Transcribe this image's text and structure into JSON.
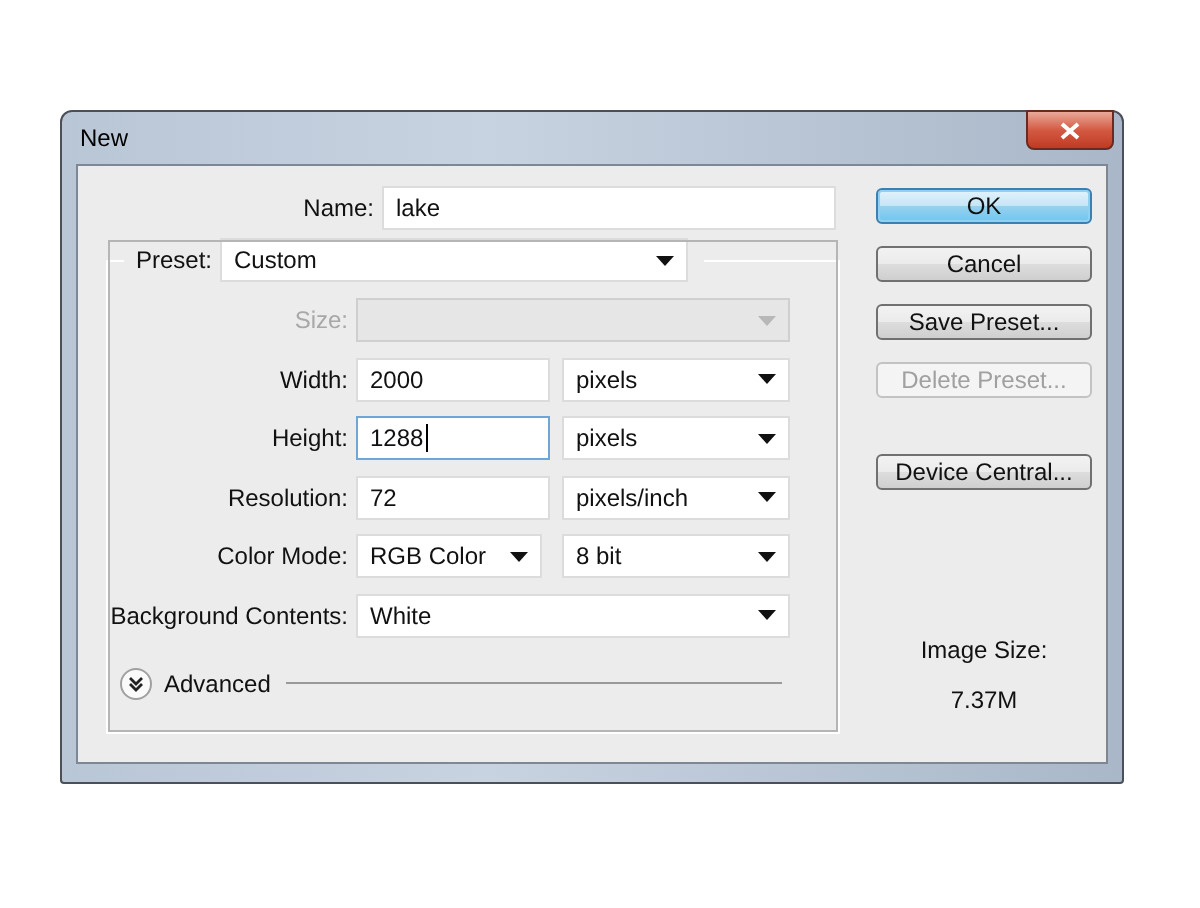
{
  "window": {
    "title": "New"
  },
  "name": {
    "label": "Name:",
    "value": "lake"
  },
  "preset": {
    "label": "Preset:",
    "value": "Custom"
  },
  "fields": [
    {
      "kind": "select-wide",
      "label": "Size:",
      "disabled": true
    },
    {
      "kind": "input-unit",
      "label": "Width:",
      "value": "2000",
      "unit": "pixels",
      "focused": false,
      "disabled": false
    },
    {
      "kind": "input-unit",
      "label": "Height:",
      "value": "1288",
      "unit": "pixels",
      "focused": true,
      "disabled": false
    },
    {
      "kind": "input-unit",
      "label": "Resolution:",
      "value": "72",
      "unit": "pixels/inch",
      "focused": false,
      "disabled": false
    },
    {
      "kind": "select-pair",
      "label": "Color Mode:",
      "value": "RGB Color",
      "unit": "8 bit",
      "disabled": false
    },
    {
      "kind": "select-wide",
      "label": "Background Contents:",
      "value": "White",
      "disabled": false
    }
  ],
  "advanced": {
    "label": "Advanced",
    "expanded": false
  },
  "buttons": [
    {
      "label": "OK",
      "default": true,
      "disabled": false
    },
    {
      "label": "Cancel",
      "default": false,
      "disabled": false
    },
    {
      "label": "Save Preset...",
      "default": false,
      "disabled": false
    },
    {
      "label": "Delete Preset...",
      "default": false,
      "disabled": true
    },
    {
      "label": "Device Central...",
      "default": false,
      "disabled": false
    }
  ],
  "image_size": {
    "label": "Image Size:",
    "value": "7.37M"
  }
}
